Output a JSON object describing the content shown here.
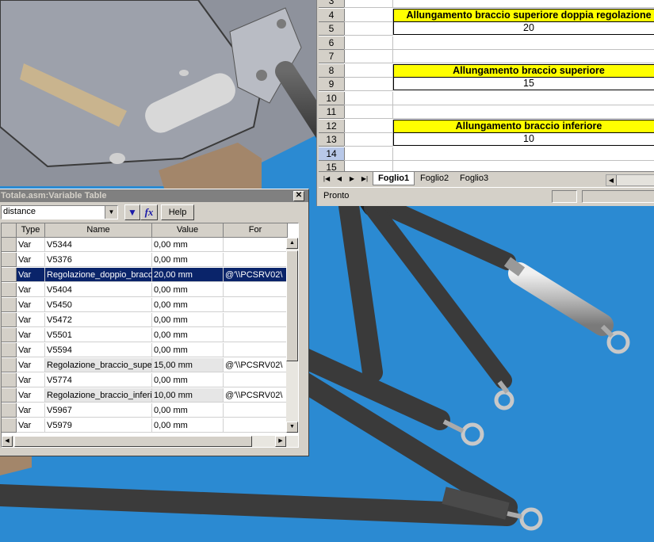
{
  "spreadsheet": {
    "rows": [
      {
        "num": "3",
        "type": "empty"
      },
      {
        "num": "4",
        "type": "header",
        "text": "Allungamento braccio superiore doppia regolazione"
      },
      {
        "num": "5",
        "type": "value",
        "text": "20"
      },
      {
        "num": "6",
        "type": "empty"
      },
      {
        "num": "7",
        "type": "empty"
      },
      {
        "num": "8",
        "type": "header",
        "text": "Allungamento braccio superiore"
      },
      {
        "num": "9",
        "type": "value",
        "text": "15"
      },
      {
        "num": "10",
        "type": "empty"
      },
      {
        "num": "11",
        "type": "empty"
      },
      {
        "num": "12",
        "type": "header",
        "text": "Allungamento braccio inferiore"
      },
      {
        "num": "13",
        "type": "value",
        "text": "10"
      },
      {
        "num": "14",
        "type": "empty",
        "selected": true
      },
      {
        "num": "15",
        "type": "empty"
      }
    ],
    "sheet_tabs": [
      "Foglio1",
      "Foglio2",
      "Foglio3"
    ],
    "active_tab": "Foglio1",
    "status": "Pronto"
  },
  "variable_table": {
    "title": "Totale.asm:Variable Table",
    "filter_value": "distance",
    "help_label": "Help",
    "fx_label": "fx",
    "columns": [
      "Type",
      "Name",
      "Value",
      "For"
    ],
    "rows": [
      {
        "type": "Var",
        "name": "V5344",
        "value": "0,00 mm",
        "formula": ""
      },
      {
        "type": "Var",
        "name": "V5376",
        "value": "0,00 mm",
        "formula": ""
      },
      {
        "type": "Var",
        "name": "Regolazione_doppio_bracc",
        "value": "20,00 mm",
        "formula": "@'\\\\PCSRV02\\",
        "selected": true
      },
      {
        "type": "Var",
        "name": "V5404",
        "value": "0,00 mm",
        "formula": ""
      },
      {
        "type": "Var",
        "name": "V5450",
        "value": "0,00 mm",
        "formula": ""
      },
      {
        "type": "Var",
        "name": "V5472",
        "value": "0,00 mm",
        "formula": ""
      },
      {
        "type": "Var",
        "name": "V5501",
        "value": "0,00 mm",
        "formula": ""
      },
      {
        "type": "Var",
        "name": "V5594",
        "value": "0,00 mm",
        "formula": ""
      },
      {
        "type": "Var",
        "name": "Regolazione_braccio_supe",
        "value": "15,00 mm",
        "formula": "@'\\\\PCSRV02\\",
        "grey": true
      },
      {
        "type": "Var",
        "name": "V5774",
        "value": "0,00 mm",
        "formula": ""
      },
      {
        "type": "Var",
        "name": "Regolazione_braccio_inferi",
        "value": "10,00 mm",
        "formula": "@'\\\\PCSRV02\\",
        "grey": true
      },
      {
        "type": "Var",
        "name": "V5967",
        "value": "0,00 mm",
        "formula": ""
      },
      {
        "type": "Var",
        "name": "V5979",
        "value": "0,00 mm",
        "formula": ""
      }
    ]
  }
}
